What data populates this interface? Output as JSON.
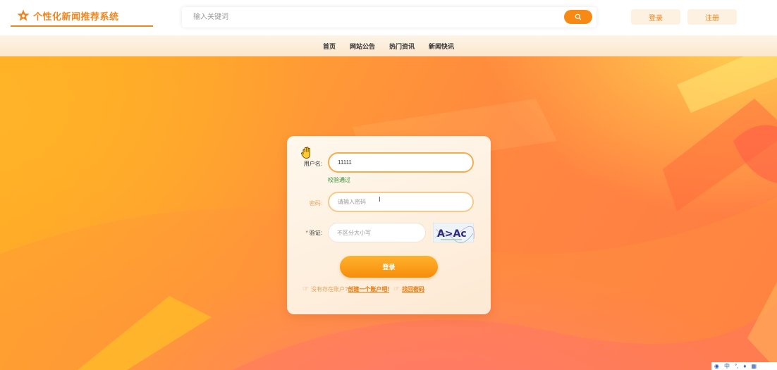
{
  "header": {
    "logo_text": "个性化新闻推荐系统",
    "search_placeholder": "输入关键词",
    "login_label": "登录",
    "register_label": "注册"
  },
  "nav": {
    "items": [
      "首页",
      "网站公告",
      "热门资讯",
      "新闻快讯"
    ]
  },
  "login_form": {
    "username_label": "用户名:",
    "username_value": "11111",
    "username_validation": "校验通过",
    "password_label": "密码:",
    "password_placeholder": "请输入密码",
    "captcha_required_mark": "*",
    "captcha_label": "验证:",
    "captcha_placeholder": "不区分大小写",
    "captcha_text": "A>Ac",
    "submit_label": "登录",
    "no_account_text": "没有存在账户?",
    "create_account_link": "创建一个账户吧!",
    "forgot_password_link": "找回密码"
  },
  "tray": {
    "ime_label": "中"
  },
  "colors": {
    "accent": "#f68a14",
    "brand": "#f0861f",
    "valid": "#2e8b32"
  }
}
